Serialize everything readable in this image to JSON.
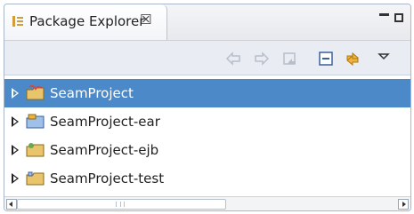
{
  "view": {
    "title": "Package Explorer",
    "close_glyph": "☒"
  },
  "toolbar": {
    "buttons": [
      {
        "name": "back-icon"
      },
      {
        "name": "forward-icon"
      },
      {
        "name": "up-icon"
      },
      {
        "name": "collapse-all-icon"
      },
      {
        "name": "link-with-editor-icon"
      },
      {
        "name": "view-menu-icon"
      }
    ]
  },
  "tree": {
    "items": [
      {
        "label": "SeamProject",
        "selected": true
      },
      {
        "label": "SeamProject-ear",
        "selected": false
      },
      {
        "label": "SeamProject-ejb",
        "selected": false
      },
      {
        "label": "SeamProject-test",
        "selected": false
      }
    ]
  },
  "colors": {
    "selection": "#4c89c9",
    "border": "#a9b7c9",
    "toolbar_bg": "#e9edf3"
  }
}
